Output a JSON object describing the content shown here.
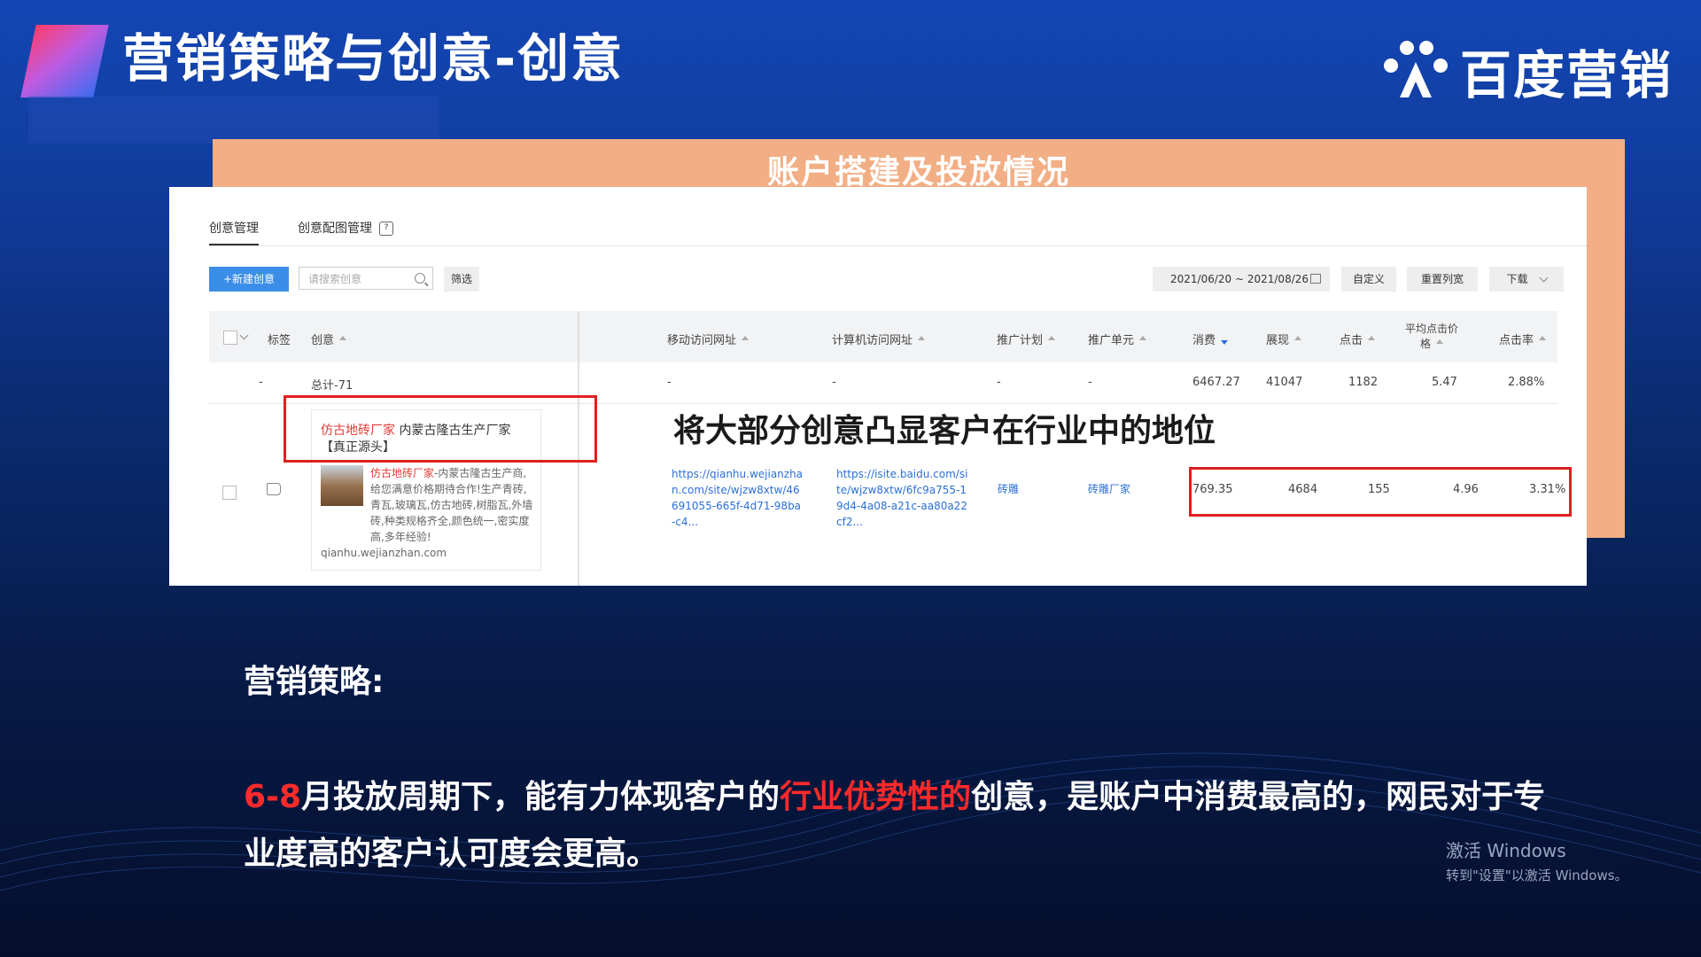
{
  "slide": {
    "title": "营销策略与创意-创意",
    "brand_text": "百度营销"
  },
  "card": {
    "heading": "账户搭建及投放情况"
  },
  "tabs": [
    {
      "label": "创意管理",
      "active": true
    },
    {
      "label": "创意配图管理",
      "active": false
    }
  ],
  "toolbar": {
    "new_button": "+新建创意",
    "search_placeholder": "请搜索创意",
    "filter_button": "筛选",
    "date_range": "2021/06/20 ~ 2021/08/26",
    "custom_button": "自定义",
    "reset_columns_button": "重置列宽",
    "download_button": "下载"
  },
  "table": {
    "headers": {
      "tag": "标签",
      "creative": "创意",
      "mobile_url": "移动访问网址",
      "pc_url": "计算机访问网址",
      "campaign": "推广计划",
      "adgroup": "推广单元",
      "cost": "消费",
      "impressions": "展现",
      "clicks": "点击",
      "avg_cpc_line1": "平均点击价",
      "avg_cpc_line2": "格",
      "ctr": "点击率"
    },
    "total_row": {
      "tag": "-",
      "creative": "总计-71",
      "mobile_url": "-",
      "pc_url": "-",
      "campaign": "-",
      "adgroup": "-",
      "cost": "6467.27",
      "impressions": "41047",
      "clicks": "1182",
      "avg_cpc": "5.47",
      "ctr": "2.88%"
    },
    "row": {
      "ad_title_red": "仿古地砖厂家",
      "ad_title_rest": " 内蒙古隆古生产厂家【真正源头】",
      "ad_desc_red": "仿古地砖厂家",
      "ad_desc_rest": "-内蒙古隆古生产商,给您满意价格期待合作!生产青砖,青瓦,玻璃瓦,仿古地砖,树脂瓦,外墙砖,种类规格齐全,颜色统一,密实度高,多年经验!",
      "ad_display_url": "qianhu.wejianzhan.com",
      "mobile_url": "https://qianhu.wejianzhan.com/site/wjzw8xtw/46691055-665f-4d71-98ba-c4...",
      "pc_url": "https://isite.baidu.com/site/wjzw8xtw/6fc9a755-19d4-4a08-a21c-aa80a22cf2...",
      "campaign": "砖雕",
      "adgroup": "砖雕厂家",
      "cost": "769.35",
      "impressions": "4684",
      "clicks": "155",
      "avg_cpc": "4.96",
      "ctr": "3.31%"
    }
  },
  "annotation": "将大部分创意凸显客户在行业中的地位",
  "strategy": {
    "label": "营销策略:",
    "text_hl1": "6-8",
    "text_part1": "月投放周期下，能有力体现客户的",
    "text_hl2": "行业优势性的",
    "text_part2": "创意，是账户中消费最高的，网民对于专业度高的客户认可度会更高。"
  },
  "watermark": {
    "line1": "激活 Windows",
    "line2": "转到\"设置\"以激活 Windows。"
  },
  "colors": {
    "highlight_red": "#ff2a2a",
    "card_orange": "#f2ae84",
    "primary_blue": "#3b8ee8"
  }
}
